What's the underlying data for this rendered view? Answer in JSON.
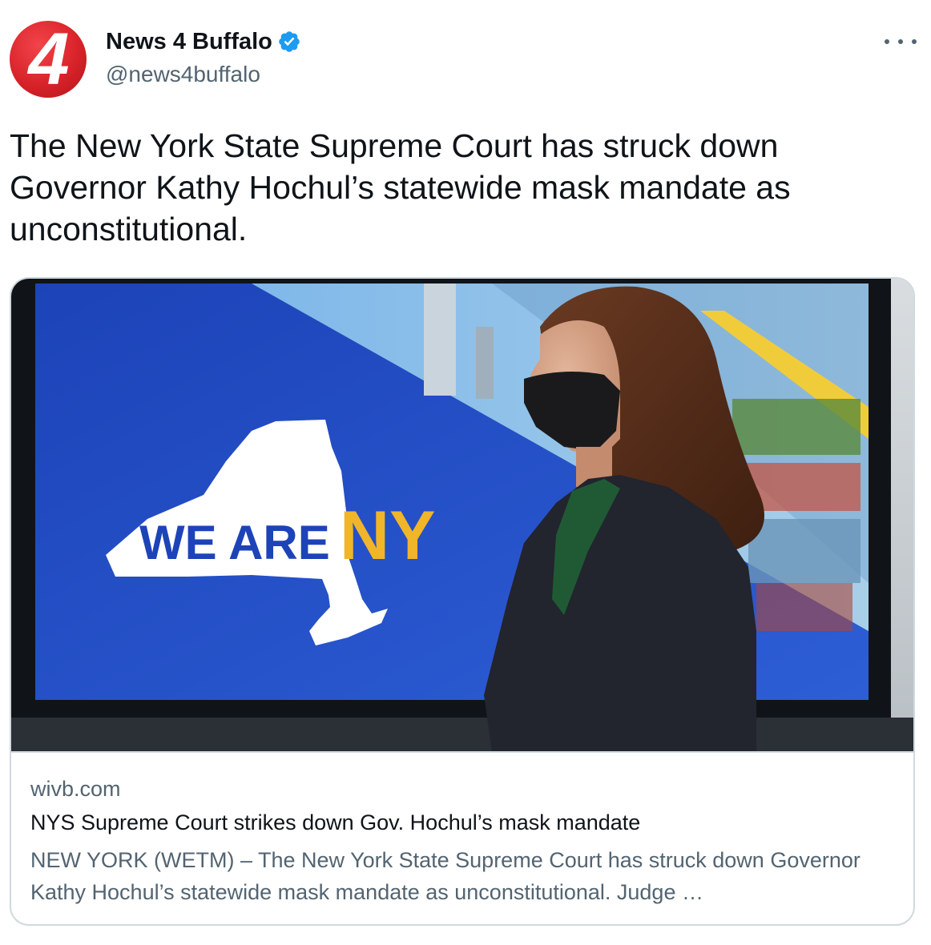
{
  "account": {
    "name": "News 4 Buffalo",
    "handle": "@news4buffalo",
    "avatar_text": "4",
    "verified_icon": "verified-badge-icon",
    "accent_color": "#1d9bf0",
    "avatar_color": "#d8232a"
  },
  "menu": {
    "more_icon": "more-options-icon"
  },
  "tweet": {
    "text": "The New York State Supreme Court has struck down Governor Kathy Hochul’s statewide mask mandate as unconstitutional."
  },
  "link_card": {
    "image_icon": "article-photo",
    "image_text_white": "WE ARE",
    "image_text_yellow": "NY",
    "domain": "wivb.com",
    "title": "NYS Supreme Court strikes down Gov. Hochul’s mask mandate",
    "description": "NEW YORK (WETM) – The New York State Supreme Court has struck down Governor Kathy Hochul’s statewide mask mandate as unconstitutional. Judge …"
  }
}
